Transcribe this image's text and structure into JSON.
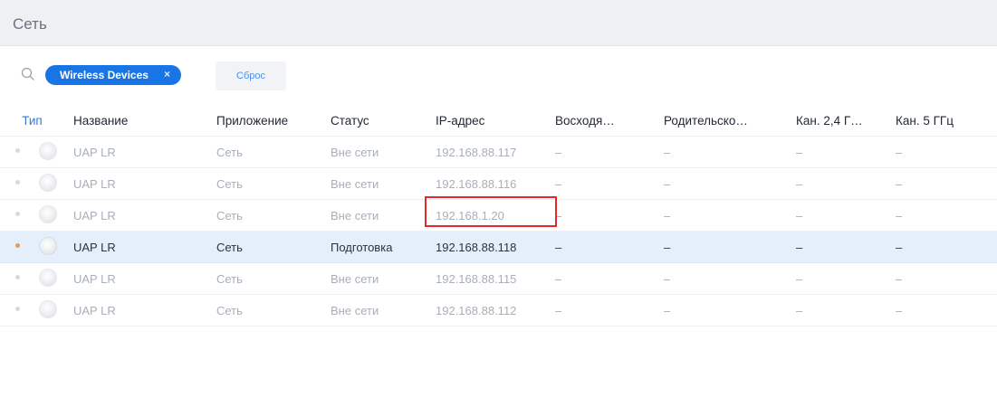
{
  "header": {
    "title": "Сеть"
  },
  "filter": {
    "search_icon": "search-icon",
    "chip_label": "Wireless Devices",
    "chip_close": "×",
    "reset_label": "Сброс"
  },
  "table": {
    "columns": [
      "Тип",
      "Название",
      "Приложение",
      "Статус",
      "IP-адрес",
      "Восходя…",
      "Родительско…",
      "Кан. 2,4 Г…",
      "Кан. 5 ГГц"
    ],
    "rows": [
      {
        "status_color": "#d6d9de",
        "name": "UAP LR",
        "app": "Сеть",
        "status": "Вне сети",
        "ip": "192.168.88.117",
        "uplink": "–",
        "parent": "–",
        "ch24": "–",
        "ch5": "–"
      },
      {
        "status_color": "#d6d9de",
        "name": "UAP LR",
        "app": "Сеть",
        "status": "Вне сети",
        "ip": "192.168.88.116",
        "uplink": "–",
        "parent": "–",
        "ch24": "–",
        "ch5": "–"
      },
      {
        "status_color": "#d6d9de",
        "name": "UAP LR",
        "app": "Сеть",
        "status": "Вне сети",
        "ip": "192.168.1.20",
        "uplink": "–",
        "parent": "–",
        "ch24": "–",
        "ch5": "–"
      },
      {
        "status_color": "#f39b31",
        "name": "UAP LR",
        "app": "Сеть",
        "status": "Подготовка",
        "ip": "192.168.88.118",
        "uplink": "–",
        "parent": "–",
        "ch24": "–",
        "ch5": "–"
      },
      {
        "status_color": "#d6d9de",
        "name": "UAP LR",
        "app": "Сеть",
        "status": "Вне сети",
        "ip": "192.168.88.115",
        "uplink": "–",
        "parent": "–",
        "ch24": "–",
        "ch5": "–"
      },
      {
        "status_color": "#d6d9de",
        "name": "UAP LR",
        "app": "Сеть",
        "status": "Вне сети",
        "ip": "192.168.88.112",
        "uplink": "–",
        "parent": "–",
        "ch24": "–",
        "ch5": "–"
      }
    ]
  },
  "colors": {
    "accent": "#1975e6",
    "highlight_row": "#e5effc",
    "highlight_box": "#e12a2a"
  }
}
